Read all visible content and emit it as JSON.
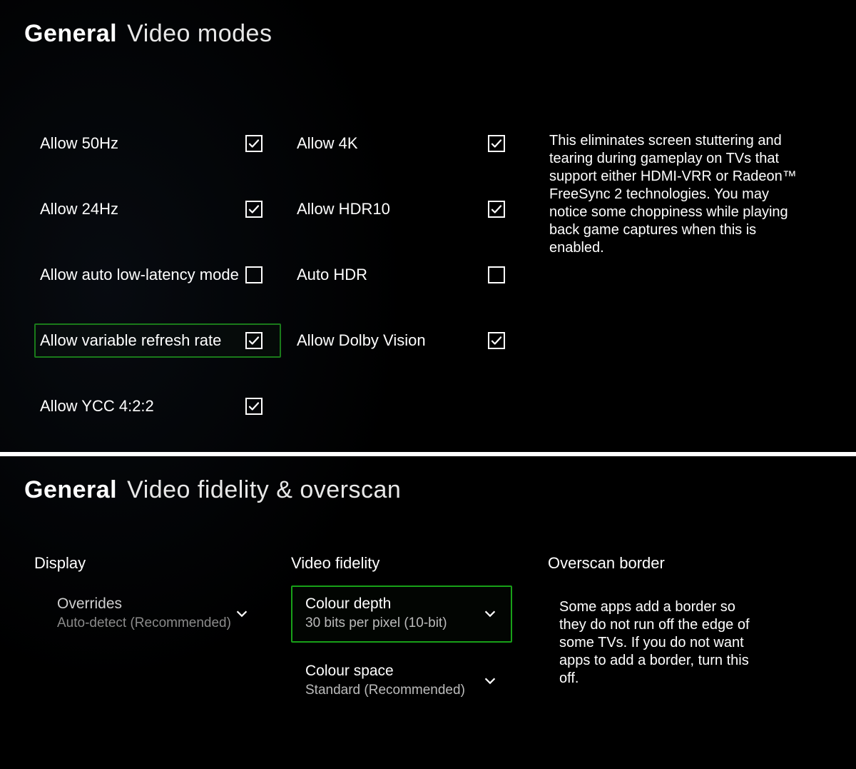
{
  "top": {
    "title_bold": "General",
    "title_light": "Video modes",
    "options_col1": [
      {
        "label": "Allow 50Hz",
        "checked": true,
        "selected": false
      },
      {
        "label": "Allow 24Hz",
        "checked": true,
        "selected": false
      },
      {
        "label": "Allow auto low-latency mode",
        "checked": false,
        "selected": false
      },
      {
        "label": "Allow variable refresh rate",
        "checked": true,
        "selected": true
      },
      {
        "label": "Allow YCC 4:2:2",
        "checked": true,
        "selected": false
      }
    ],
    "options_col2": [
      {
        "label": "Allow 4K",
        "checked": true,
        "selected": false
      },
      {
        "label": "Allow HDR10",
        "checked": true,
        "selected": false
      },
      {
        "label": "Auto HDR",
        "checked": false,
        "selected": false
      },
      {
        "label": "Allow Dolby Vision",
        "checked": true,
        "selected": false
      }
    ],
    "help_text": "This eliminates screen stuttering and tearing during gameplay on TVs that support either HDMI-VRR or Radeon™ FreeSync 2 technologies. You may notice some choppiness while playing back game captures when this is enabled."
  },
  "bottom": {
    "title_bold": "General",
    "title_light": "Video fidelity & overscan",
    "display": {
      "heading": "Display",
      "overrides": {
        "label": "Overrides",
        "value": "Auto-detect (Recommended)"
      }
    },
    "fidelity": {
      "heading": "Video fidelity",
      "colour_depth": {
        "label": "Colour depth",
        "value": "30 bits per pixel (10-bit)",
        "selected": true
      },
      "colour_space": {
        "label": "Colour space",
        "value": "Standard (Recommended)",
        "selected": false
      }
    },
    "overscan": {
      "heading": "Overscan border",
      "text": "Some apps add a border so they do not run off the edge of some TVs. If you do not want apps to add a border, turn this off."
    }
  }
}
